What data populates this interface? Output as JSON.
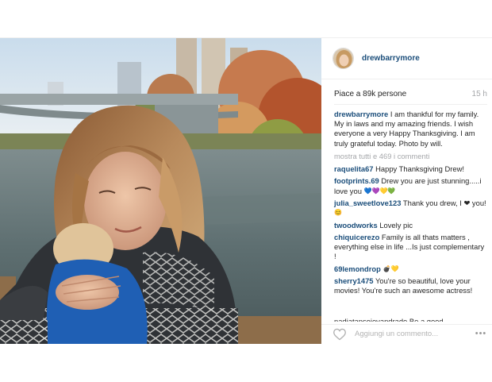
{
  "post": {
    "username": "drewbarrymore",
    "likes_text": "Piace a 89k persone",
    "time_ago": "15 h",
    "caption_author": "drewbarrymore",
    "caption_text": "I am thankful for my family. My in laws and my amazing friends. I wish everyone a very Happy Thanksgiving. I am truly grateful today. Photo by will.",
    "view_all_text": "mostra tutti e 469 i commenti"
  },
  "comments": [
    {
      "author": "raquelita67",
      "text": "Happy Thanksgiving Drew!",
      "emoji": ""
    },
    {
      "author": "footprints.69",
      "text": "Drew you are just stunning.....i love you",
      "emoji": "💙💜💛💚"
    },
    {
      "author": "julia_sweetlove123",
      "text": "Thank you drew, I ❤ you!",
      "emoji": "😊"
    },
    {
      "author": "twoodworks",
      "text": "Lovely pic",
      "emoji": ""
    },
    {
      "author": "chiquicerezo",
      "text": "Family is all thats matters , everything else in life ...Is just complementary !",
      "emoji": ""
    },
    {
      "author": "69lemondrop",
      "text": "",
      "emoji": "💣💛"
    },
    {
      "author": "sherry1475",
      "text": "You're so beautiful, love your movies! You're such an awesome actress!",
      "emoji": ""
    }
  ],
  "cut_comment": "nadiatapsoievandrade Be a good",
  "add_comment": {
    "placeholder": "Aggiungi un commento..."
  },
  "more_label": "•••",
  "icons": {
    "like": "heart-outline-icon",
    "more": "more-options-icon"
  }
}
